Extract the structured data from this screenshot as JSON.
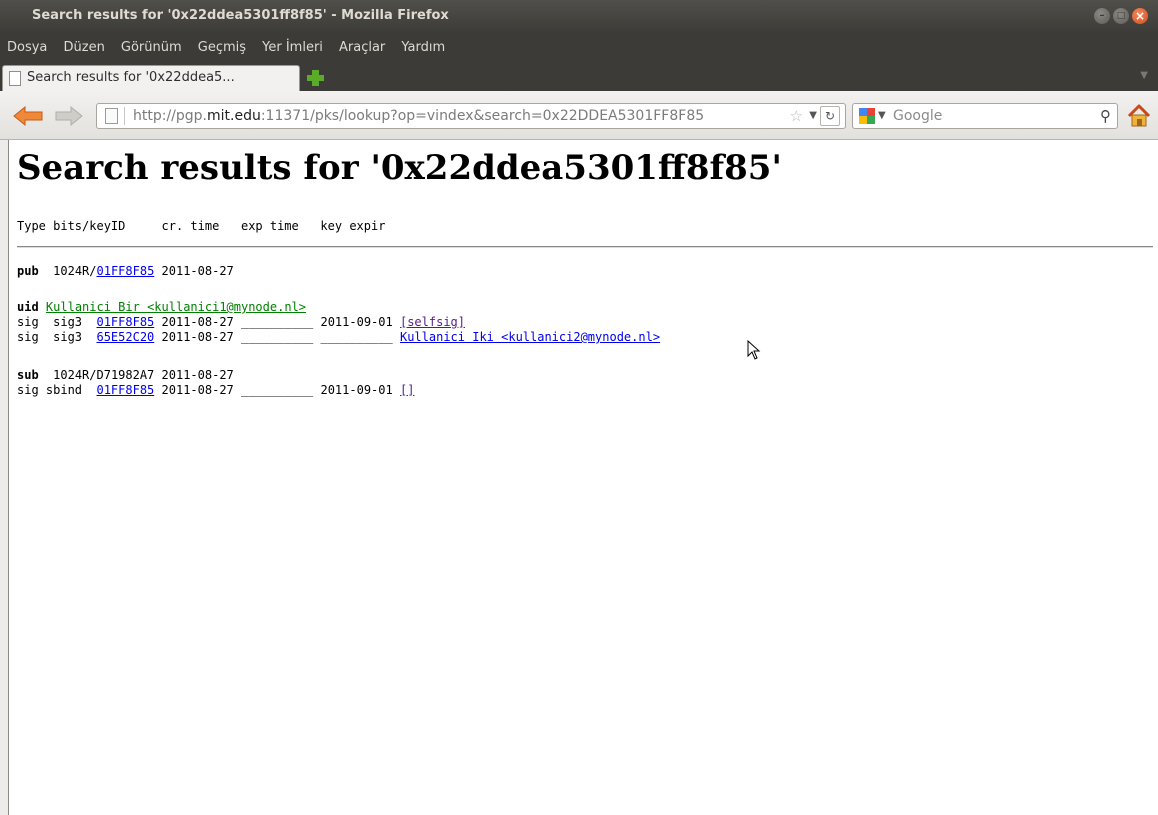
{
  "window": {
    "title": "Search results for '0x22ddea5301ff8f85' - Mozilla Firefox"
  },
  "menubar": {
    "items": [
      "Dosya",
      "Düzen",
      "Görünüm",
      "Geçmiş",
      "Yer İmleri",
      "Araçlar",
      "Yardım"
    ]
  },
  "tabs": {
    "active_label": "Search results for '0x22ddea5...",
    "new_tab_icon": "plus-icon"
  },
  "navbar": {
    "url_prefix": "http://pgp.",
    "url_domain": "mit.edu",
    "url_suffix": ":11371/pks/lookup?op=vindex&search=0x22DDEA5301FF8F85",
    "search_placeholder": "Google",
    "search_engine_icon": "google-icon",
    "home_icon": "home-icon"
  },
  "page": {
    "heading": "Search results for '0x22ddea5301ff8f85'",
    "table_header": "Type bits/keyID     cr. time   exp time   key expir",
    "pub": {
      "type": "pub",
      "bits_prefix": "1024R/",
      "keyid": "01FF8F85",
      "date": "2011-08-27"
    },
    "uid": {
      "type": "uid",
      "name": "Kullanici Bir <kullanici1@mynode.nl>"
    },
    "sigs": [
      {
        "prefix": "sig  sig3  ",
        "keyid": "01FF8F85",
        "date": "2011-08-27",
        "blank1": "__________",
        "exp": "2011-09-01",
        "label": "[selfsig]"
      },
      {
        "prefix": "sig  sig3  ",
        "keyid": "65E52C20",
        "date": "2011-08-27",
        "blank1": "__________",
        "blank2": "__________",
        "label": "Kullanici Iki <kullanici2@mynode.nl>"
      }
    ],
    "sub": {
      "type": "sub",
      "bits": "1024R/D71982A7",
      "date": "2011-08-27"
    },
    "sbind": {
      "prefix": "sig sbind  ",
      "keyid": "01FF8F85",
      "date": "2011-08-27",
      "blank1": "__________",
      "exp": "2011-09-01",
      "label": "[]"
    }
  }
}
